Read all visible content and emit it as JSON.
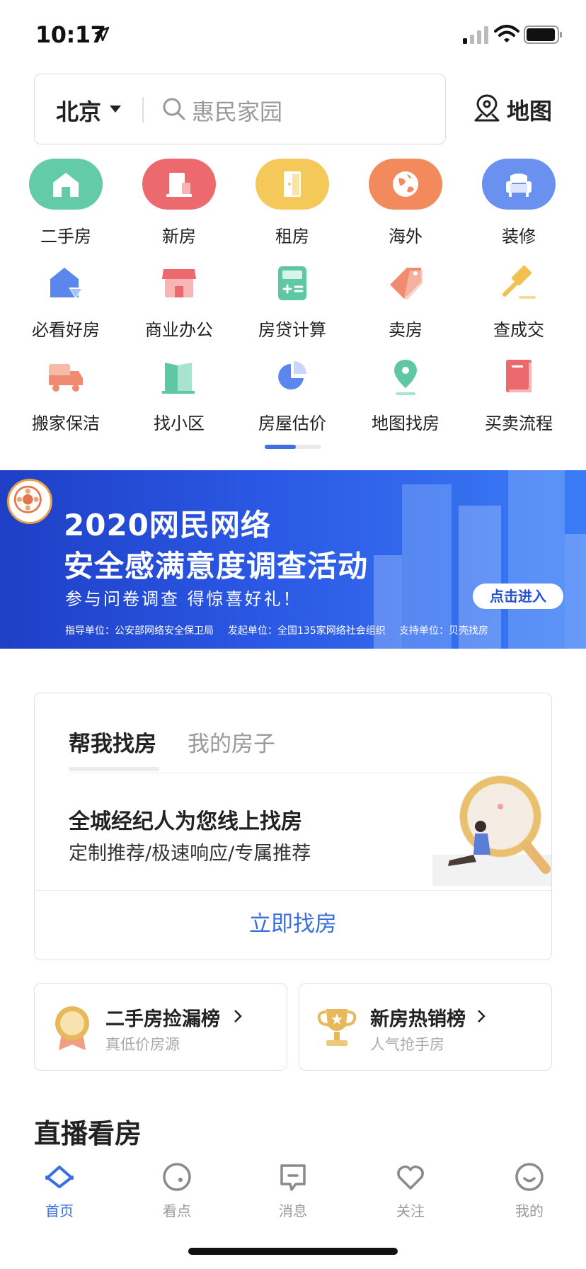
{
  "status": {
    "time": "10:17"
  },
  "search": {
    "city": "北京",
    "placeholder": "惠民家园"
  },
  "map_button": {
    "label": "地图"
  },
  "categories_main": [
    {
      "label": "二手房",
      "icon": "house-icon",
      "color": "#63cba8"
    },
    {
      "label": "新房",
      "icon": "building-icon",
      "color": "#ec6a6d"
    },
    {
      "label": "租房",
      "icon": "door-icon",
      "color": "#f5c85a"
    },
    {
      "label": "海外",
      "icon": "globe-icon",
      "color": "#f28a5d"
    },
    {
      "label": "装修",
      "icon": "sofa-icon",
      "color": "#6b91f0"
    }
  ],
  "categories_row2": [
    {
      "label": "必看好房",
      "icon": "shield-house-icon"
    },
    {
      "label": "商业办公",
      "icon": "shop-icon"
    },
    {
      "label": "房贷计算",
      "icon": "calculator-icon"
    },
    {
      "label": "卖房",
      "icon": "price-tag-icon"
    },
    {
      "label": "查成交",
      "icon": "gavel-icon"
    }
  ],
  "categories_row3": [
    {
      "label": "搬家保洁",
      "icon": "truck-icon"
    },
    {
      "label": "找小区",
      "icon": "buildings-icon"
    },
    {
      "label": "房屋估价",
      "icon": "pie-chart-icon"
    },
    {
      "label": "地图找房",
      "icon": "map-pin-icon"
    },
    {
      "label": "买卖流程",
      "icon": "book-icon"
    }
  ],
  "banner": {
    "title_line1": "2020网民网络",
    "title_line2": "安全感满意度调查活动",
    "subtitle": "参与问卷调查  得惊喜好礼！",
    "cta": "点击进入",
    "footer1": "指导单位：公安部网络安全保卫局",
    "footer2": "发起单位：全国135家网络社会组织",
    "footer3": "支持单位：贝壳找房"
  },
  "find_card": {
    "tab_active": "帮我找房",
    "tab_inactive": "我的房子",
    "headline": "全城经纪人为您线上找房",
    "subline": "定制推荐/极速响应/专属推荐",
    "action": "立即找房"
  },
  "ranks": [
    {
      "title": "二手房捡漏榜",
      "subtitle": "真低价房源",
      "icon": "medal-icon"
    },
    {
      "title": "新房热销榜",
      "subtitle": "人气抢手房",
      "icon": "trophy-icon"
    }
  ],
  "live_section": {
    "title": "直播看房"
  },
  "tabbar": [
    {
      "label": "首页",
      "icon": "home-icon",
      "active": true
    },
    {
      "label": "看点",
      "icon": "discover-icon"
    },
    {
      "label": "消息",
      "icon": "message-icon"
    },
    {
      "label": "关注",
      "icon": "heart-icon"
    },
    {
      "label": "我的",
      "icon": "profile-icon"
    }
  ],
  "colors": {
    "accent": "#3b6fe0",
    "banner_start": "#1e3fc6",
    "banner_end": "#3a7cf6"
  }
}
